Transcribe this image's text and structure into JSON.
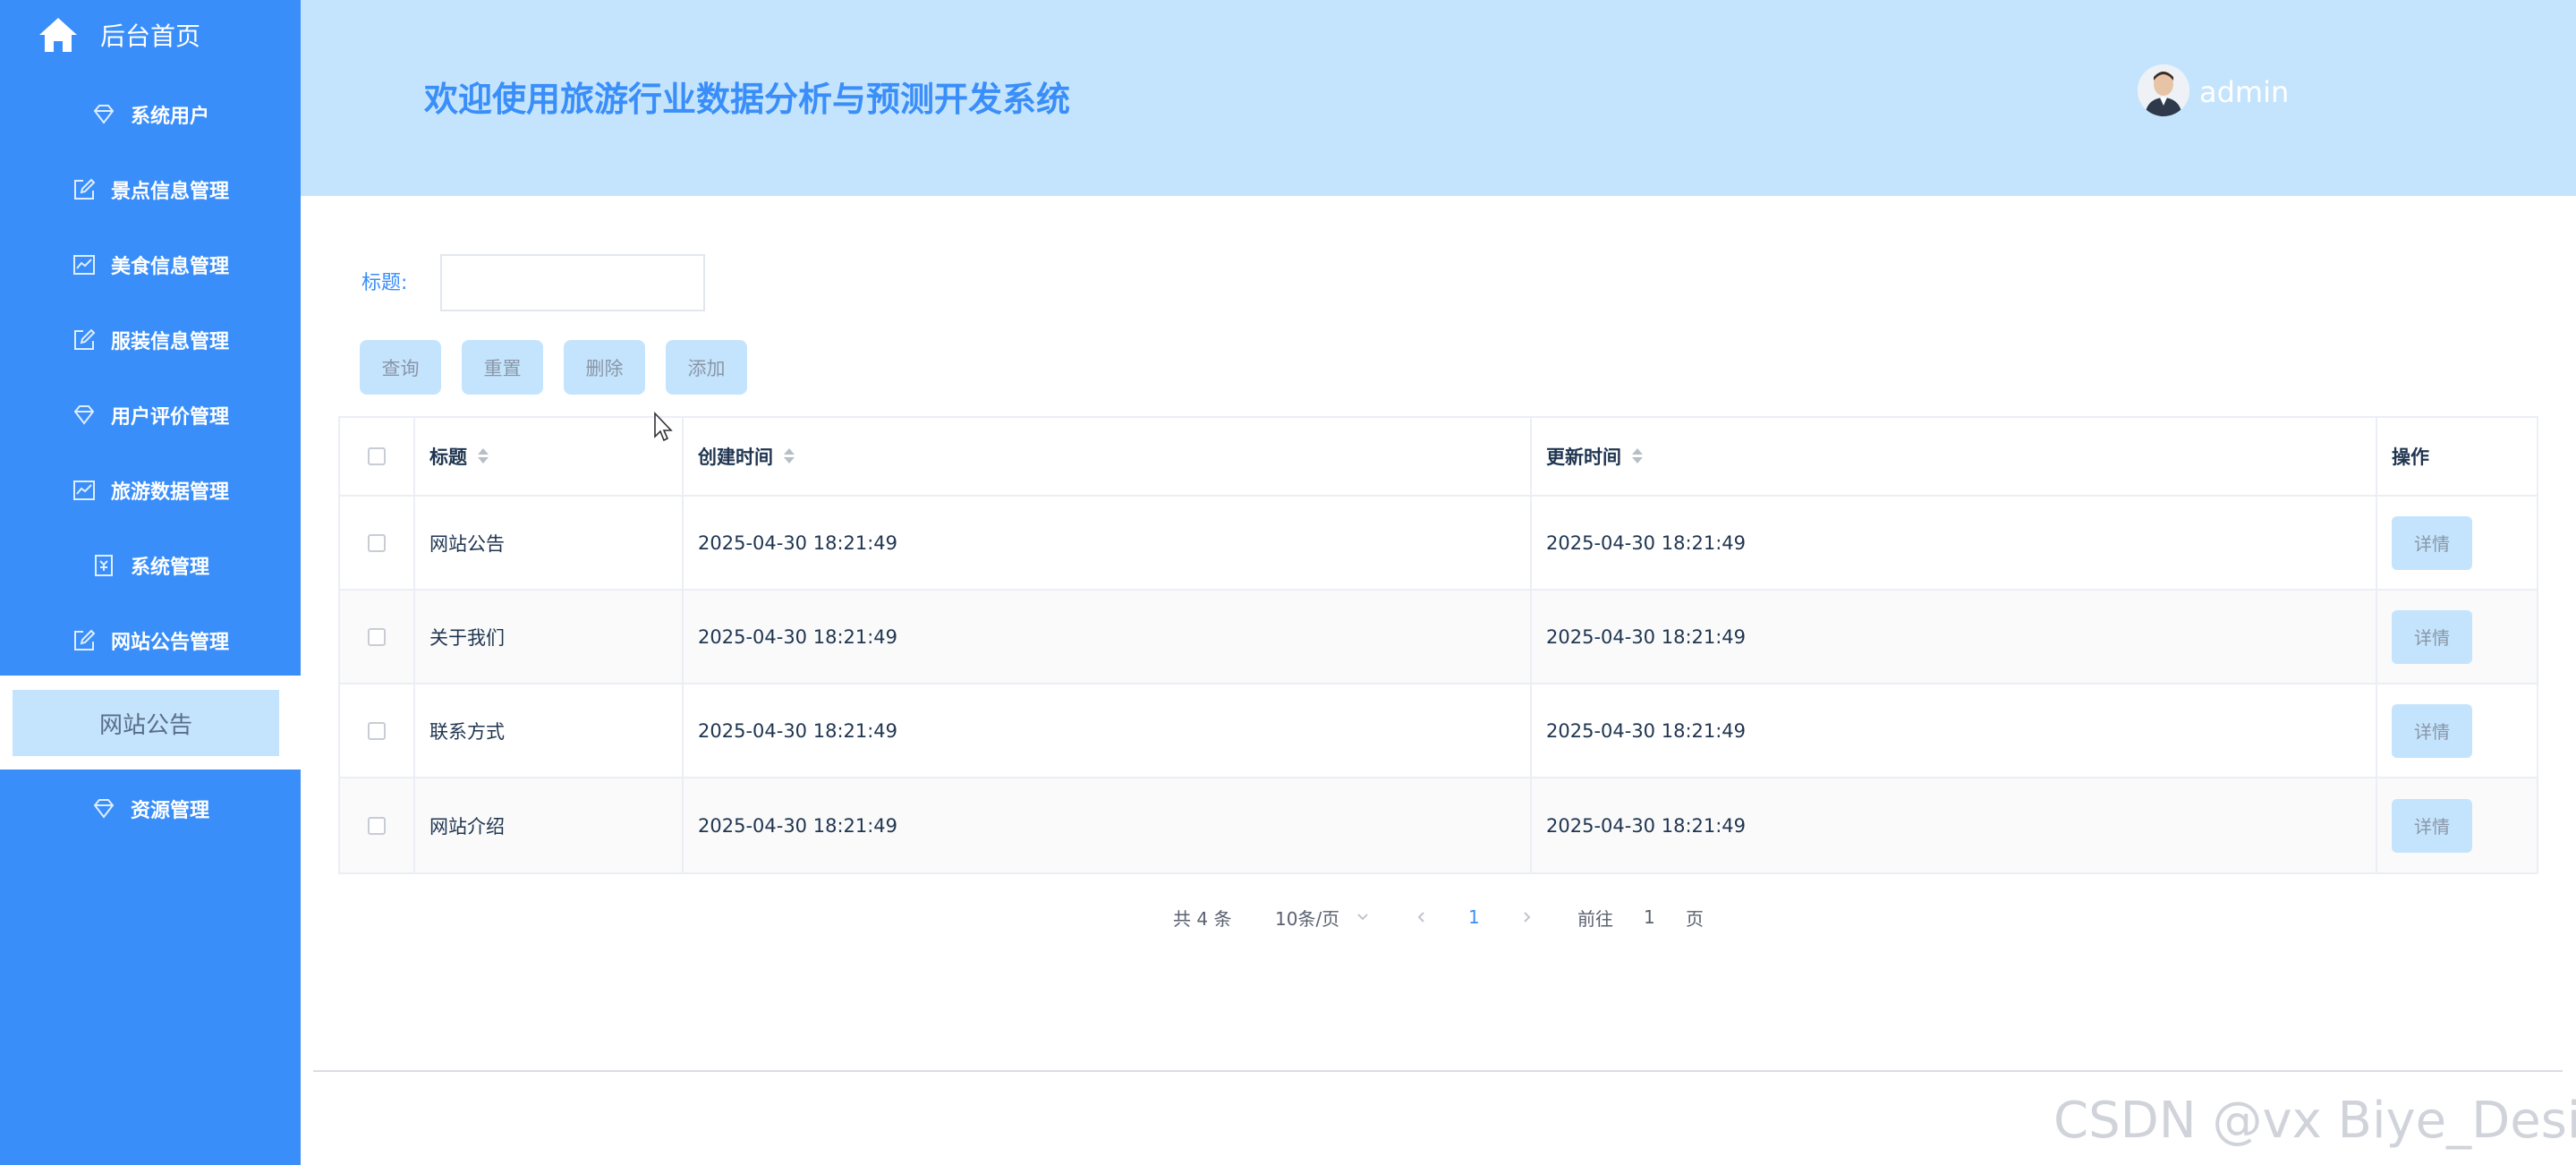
{
  "sidebar": {
    "home_label": "后台首页",
    "items": [
      {
        "label": "系统用户",
        "icon": "diamond-icon"
      },
      {
        "label": "景点信息管理",
        "icon": "edit-icon"
      },
      {
        "label": "美食信息管理",
        "icon": "chart-icon"
      },
      {
        "label": "服装信息管理",
        "icon": "edit-icon"
      },
      {
        "label": "用户评价管理",
        "icon": "diamond-icon"
      },
      {
        "label": "旅游数据管理",
        "icon": "chart-icon"
      },
      {
        "label": "系统管理",
        "icon": "badge-icon"
      },
      {
        "label": "网站公告管理",
        "icon": "edit-icon"
      },
      {
        "label": "资源管理",
        "icon": "diamond-icon"
      }
    ],
    "active_sub_label": "网站公告"
  },
  "header": {
    "title": "欢迎使用旅游行业数据分析与预测开发系统",
    "username": "admin"
  },
  "search": {
    "label": "标题:",
    "value": "",
    "placeholder": ""
  },
  "buttons": {
    "query": "查询",
    "reset": "重置",
    "delete": "删除",
    "add": "添加"
  },
  "table": {
    "columns": [
      "标题",
      "创建时间",
      "更新时间",
      "操作"
    ],
    "rows": [
      {
        "title": "网站公告",
        "created": "2025-04-30 18:21:49",
        "updated": "2025-04-30 18:21:49",
        "action": "详情"
      },
      {
        "title": "关于我们",
        "created": "2025-04-30 18:21:49",
        "updated": "2025-04-30 18:21:49",
        "action": "详情"
      },
      {
        "title": "联系方式",
        "created": "2025-04-30 18:21:49",
        "updated": "2025-04-30 18:21:49",
        "action": "详情"
      },
      {
        "title": "网站介绍",
        "created": "2025-04-30 18:21:49",
        "updated": "2025-04-30 18:21:49",
        "action": "详情"
      }
    ]
  },
  "pagination": {
    "total": "共 4 条",
    "page_size": "10条/页",
    "current_page": "1",
    "goto_label": "前往",
    "goto_value": "1",
    "page_suffix": "页"
  },
  "watermark": "CSDN @vx Biye_Design",
  "colors": {
    "sidebar": "#3a8ef9",
    "header": "#c4e4fd",
    "accent": "#3a8ef9"
  }
}
